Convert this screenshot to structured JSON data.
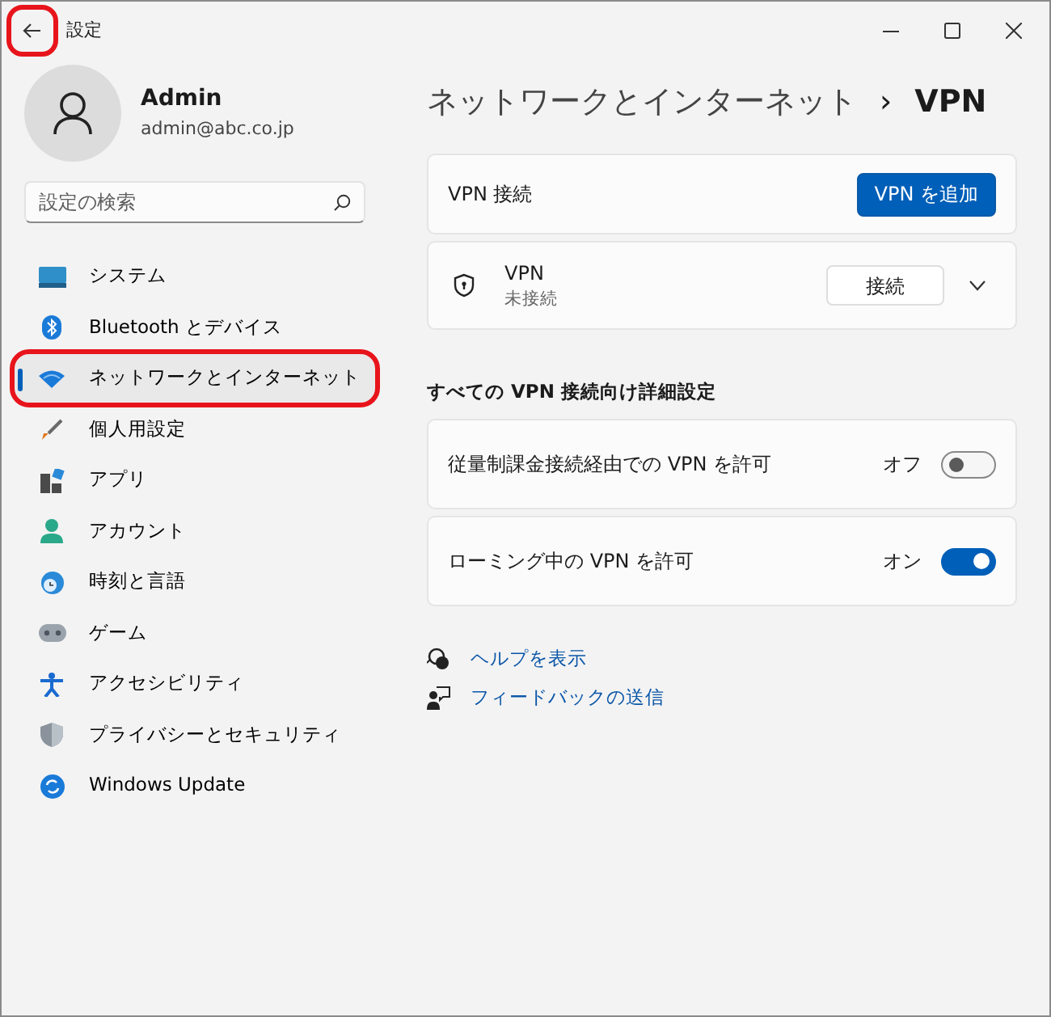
{
  "window": {
    "title": "設定",
    "back_highlighted": true
  },
  "account": {
    "name": "Admin",
    "email": "admin@abc.co.jp"
  },
  "search": {
    "placeholder": "設定の検索"
  },
  "sidebar": {
    "items": [
      {
        "label": "システム",
        "selected": false,
        "highlighted": false
      },
      {
        "label": "Bluetooth とデバイス",
        "selected": false,
        "highlighted": false
      },
      {
        "label": "ネットワークとインターネット",
        "selected": true,
        "highlighted": true
      },
      {
        "label": "個人用設定",
        "selected": false,
        "highlighted": false
      },
      {
        "label": "アプリ",
        "selected": false,
        "highlighted": false
      },
      {
        "label": "アカウント",
        "selected": false,
        "highlighted": false
      },
      {
        "label": "時刻と言語",
        "selected": false,
        "highlighted": false
      },
      {
        "label": "ゲーム",
        "selected": false,
        "highlighted": false
      },
      {
        "label": "アクセシビリティ",
        "selected": false,
        "highlighted": false
      },
      {
        "label": "プライバシーとセキュリティ",
        "selected": false,
        "highlighted": false
      },
      {
        "label": "Windows Update",
        "selected": false,
        "highlighted": false
      }
    ]
  },
  "breadcrumb": {
    "parent": "ネットワークとインターネット",
    "separator": "›",
    "current": "VPN"
  },
  "vpn_connections": {
    "label": "VPN 接続",
    "button": "VPN を追加"
  },
  "vpn_entry": {
    "name": "VPN",
    "status": "未接続",
    "button": "接続",
    "expanded": false
  },
  "advanced": {
    "heading": "すべての VPN 接続向け詳細設定",
    "settings": [
      {
        "label": "従量制課金接続経由での VPN を許可",
        "state_text": "オフ",
        "on": false
      },
      {
        "label": "ローミング中の VPN を許可",
        "state_text": "オン",
        "on": true
      }
    ]
  },
  "links": [
    "ヘルプを表示",
    "フィードバックの送信"
  ]
}
